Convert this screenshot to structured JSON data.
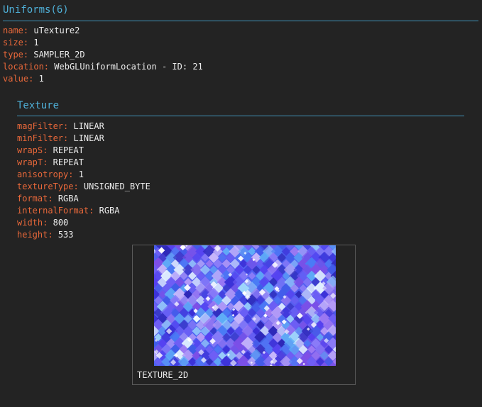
{
  "uniforms": {
    "title": "Uniforms(6)",
    "props": [
      {
        "key": "name:",
        "value": "uTexture2"
      },
      {
        "key": "size:",
        "value": "1"
      },
      {
        "key": "type:",
        "value": "SAMPLER_2D"
      },
      {
        "key": "location:",
        "value": "WebGLUniformLocation - ID: 21"
      },
      {
        "key": "value:",
        "value": "1"
      }
    ]
  },
  "texture": {
    "title": "Texture",
    "props": [
      {
        "key": "magFilter:",
        "value": "LINEAR"
      },
      {
        "key": "minFilter:",
        "value": "LINEAR"
      },
      {
        "key": "wrapS:",
        "value": "REPEAT"
      },
      {
        "key": "wrapT:",
        "value": "REPEAT"
      },
      {
        "key": "anisotropy:",
        "value": "1"
      },
      {
        "key": "textureType:",
        "value": "UNSIGNED_BYTE"
      },
      {
        "key": "format:",
        "value": "RGBA"
      },
      {
        "key": "internalFormat:",
        "value": "RGBA"
      },
      {
        "key": "width:",
        "value": "800"
      },
      {
        "key": "height:",
        "value": "533"
      }
    ],
    "preview": {
      "label": "TEXTURE_2D",
      "image": "blue-purple-diamond-mosaic"
    }
  },
  "colors": {
    "background": "#232323",
    "key": "#e9683a",
    "value": "#ececec",
    "title": "#4fb0d8",
    "rule": "#3f93b8"
  }
}
